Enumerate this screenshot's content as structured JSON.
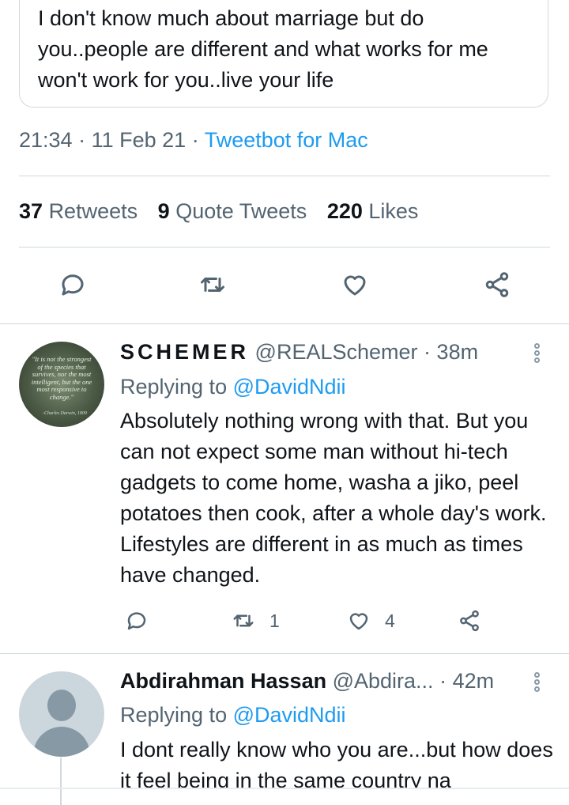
{
  "quoted_tweet": {
    "text": "I don't know much about marriage but do you..people are different and what works for me won't work for you..live your life"
  },
  "main_tweet": {
    "time": "21:34",
    "date": "11 Feb 21",
    "source": "Tweetbot for Mac",
    "stats": {
      "retweets_count": "37",
      "retweets_label": "Retweets",
      "quotes_count": "9",
      "quotes_label": "Quote Tweets",
      "likes_count": "220",
      "likes_label": "Likes"
    }
  },
  "replies": [
    {
      "display_name": "SCHEMER",
      "handle": "@REALSchemer",
      "time": "38m",
      "replying_label": "Replying to",
      "replying_to": "@DavidNdii",
      "text": "Absolutely nothing wrong with that. But you can not expect some man without hi-tech gadgets to come home, washa a jiko, peel potatoes then cook, after a whole day's work. Lifestyles are different in as much as times have changed.",
      "avatar_quote": "\"It is not the strongest of the species that survives, nor the most intelligent, but the one most responsive to change.\"",
      "avatar_attribution": "-Charles Darwin, 1809",
      "retweets": "1",
      "likes": "4"
    },
    {
      "display_name": "Abdirahman Hassan",
      "handle": "@Abdira...",
      "time": "42m",
      "replying_label": "Replying to",
      "replying_to": "@DavidNdii",
      "text": "I dont really know who you are...but how does it feel being in the same country na"
    }
  ],
  "colors": {
    "accent": "#1d9bf0",
    "text": "#0f1419",
    "secondary": "#536471",
    "divider": "#cfd9de"
  },
  "icons": [
    "reply-icon",
    "retweet-icon",
    "like-icon",
    "share-icon",
    "more-icon"
  ]
}
